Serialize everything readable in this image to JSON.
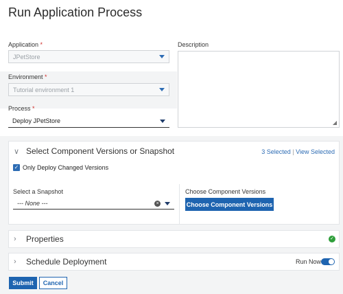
{
  "page": {
    "title": "Run Application Process"
  },
  "form": {
    "application": {
      "label": "Application",
      "required_mark": "*",
      "value": "JPetStore"
    },
    "environment": {
      "label": "Environment",
      "required_mark": "*",
      "value": "Tutorial environment 1"
    },
    "process": {
      "label": "Process",
      "required_mark": "*",
      "value": "Deploy JPetStore"
    },
    "description": {
      "label": "Description",
      "value": ""
    }
  },
  "component_section": {
    "title": "Select Component Versions or Snapshot",
    "selected_count": "3 Selected",
    "separator": "|",
    "view_selected": "View Selected",
    "only_changed_label": "Only Deploy Changed Versions",
    "only_changed_checked": true,
    "snapshot": {
      "label": "Select a Snapshot",
      "value": "--- None ---"
    },
    "versions": {
      "label": "Choose Component Versions",
      "button": "Choose Component Versions"
    }
  },
  "properties_section": {
    "title": "Properties",
    "status_icon": "check-circle-icon"
  },
  "schedule_section": {
    "title": "Schedule Deployment",
    "run_now_label": "Run Now",
    "run_now_on": true
  },
  "actions": {
    "submit": "Submit",
    "cancel": "Cancel"
  },
  "colors": {
    "primary": "#1e64b0",
    "required": "#d0302c",
    "success": "#2e9e3a"
  }
}
